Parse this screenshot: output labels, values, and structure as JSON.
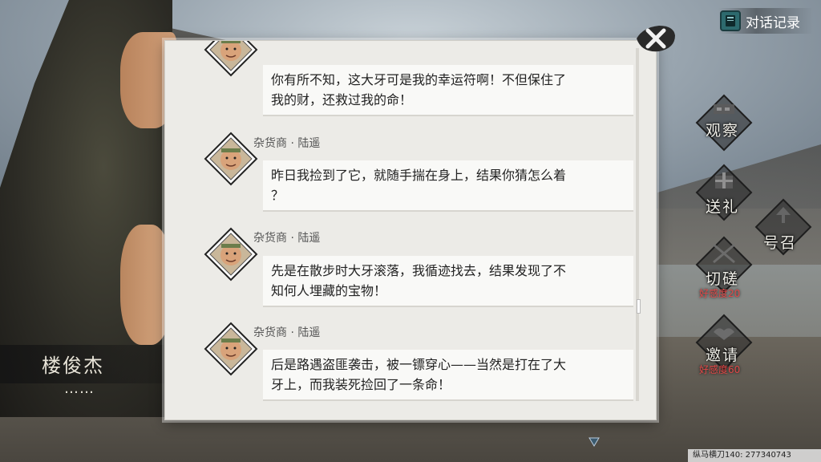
{
  "character": {
    "name": "楼俊杰",
    "ellipsis": "……"
  },
  "header": {
    "log_button_label": "对话记录"
  },
  "messages": [
    {
      "speaker": "",
      "lines": [
        "你有所不知，这大牙可是我的幸运符啊！不但保住了",
        "我的财，还救过我的命！"
      ]
    },
    {
      "speaker": "杂货商 · 陆遥",
      "lines": [
        "昨日我捡到了它，就随手揣在身上，结果你猜怎么着",
        "？"
      ]
    },
    {
      "speaker": "杂货商 · 陆遥",
      "lines": [
        "先是在散步时大牙滚落，我循迹找去，结果发现了不",
        "知何人埋藏的宝物！"
      ]
    },
    {
      "speaker": "杂货商 · 陆遥",
      "lines": [
        "后是路遇盗匪袭击，被一镖穿心——当然是打在了大",
        "牙上，而我装死捡回了一条命！"
      ]
    }
  ],
  "actions": {
    "observe": {
      "label": "观察"
    },
    "gift": {
      "label": "送礼"
    },
    "summon": {
      "label": "号召"
    },
    "spar": {
      "label": "切磋",
      "requirement": "好感度20"
    },
    "invite": {
      "label": "邀请",
      "requirement": "好感度60"
    }
  },
  "footer": {
    "text": "纵马横刀140: 277340743"
  },
  "colors": {
    "requirement_red": "#e04747",
    "panel_bg": "#ecebe7"
  }
}
